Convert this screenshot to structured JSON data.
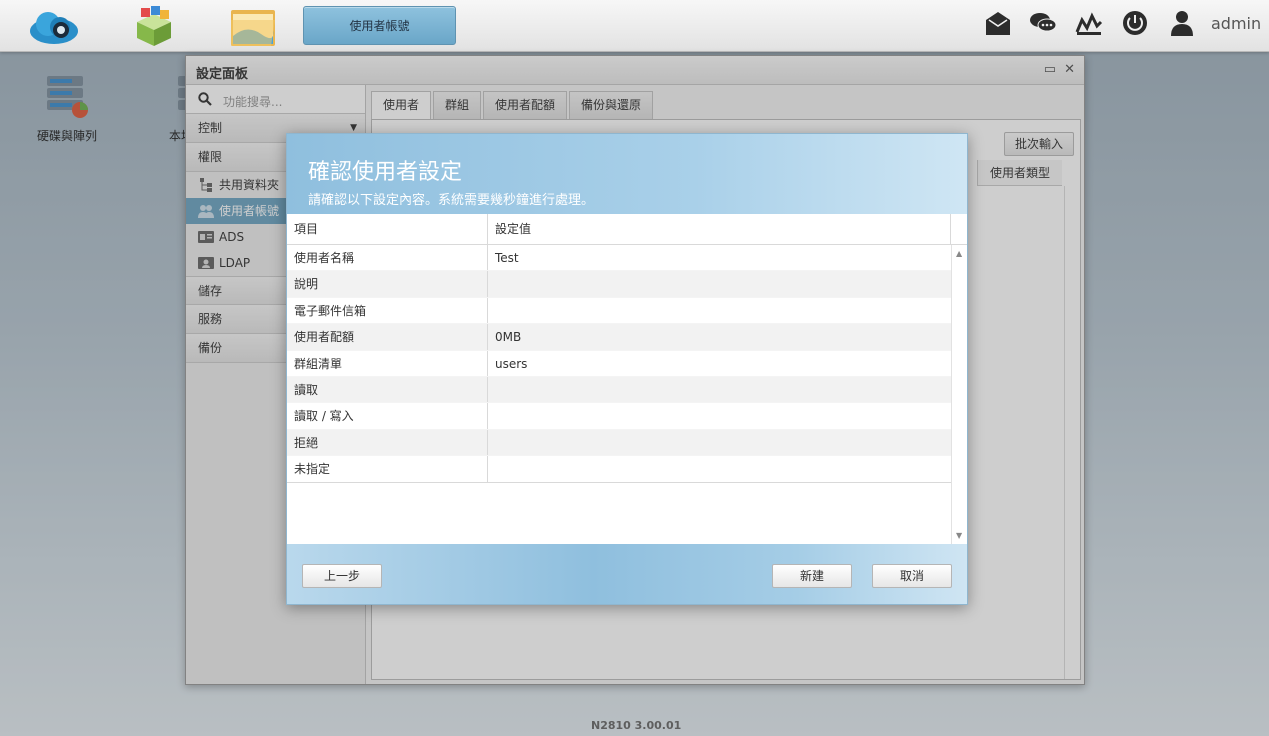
{
  "topbar": {
    "active_app": "使用者帳號",
    "user": "admin",
    "icons": [
      "cloud-icon",
      "packages-icon",
      "folder-icon",
      "mail-icon",
      "chat-icon",
      "monitor-icon",
      "power-icon",
      "user-icon"
    ]
  },
  "desktop": {
    "icons": [
      {
        "label": "硬碟與陣列"
      },
      {
        "label": "本地"
      }
    ]
  },
  "control_panel": {
    "title": "設定面板",
    "search_placeholder": "功能搜尋...",
    "categories": {
      "control": "控制",
      "privilege": "權限",
      "storage": "儲存",
      "service": "服務",
      "backup": "備份"
    },
    "privilege_items": [
      {
        "label": "共用資料夾"
      },
      {
        "label": "使用者帳號"
      },
      {
        "label": "ADS"
      },
      {
        "label": "LDAP"
      }
    ],
    "tabs": [
      "使用者",
      "群組",
      "使用者配額",
      "備份與還原"
    ],
    "batch_button": "批次輸入",
    "column_user_type": "使用者類型"
  },
  "dialog": {
    "title": "確認使用者設定",
    "subtitle": "請確認以下設定內容。系統需要幾秒鐘進行處理。",
    "columns": {
      "item": "項目",
      "value": "設定值"
    },
    "rows": [
      {
        "item": "使用者名稱",
        "value": "Test"
      },
      {
        "item": "說明",
        "value": ""
      },
      {
        "item": "電子郵件信箱",
        "value": ""
      },
      {
        "item": "使用者配額",
        "value": "0MB"
      },
      {
        "item": "群組清單",
        "value": "users"
      },
      {
        "item": "讀取",
        "value": ""
      },
      {
        "item": "讀取 / 寫入",
        "value": ""
      },
      {
        "item": "拒絕",
        "value": ""
      },
      {
        "item": "未指定",
        "value": ""
      }
    ],
    "buttons": {
      "back": "上一步",
      "create": "新建",
      "cancel": "取消"
    }
  },
  "footer": {
    "version": "N2810   3.00.01"
  },
  "colors": {
    "accent": "#6ea4c2",
    "dialog_header": "#8fbfde"
  }
}
